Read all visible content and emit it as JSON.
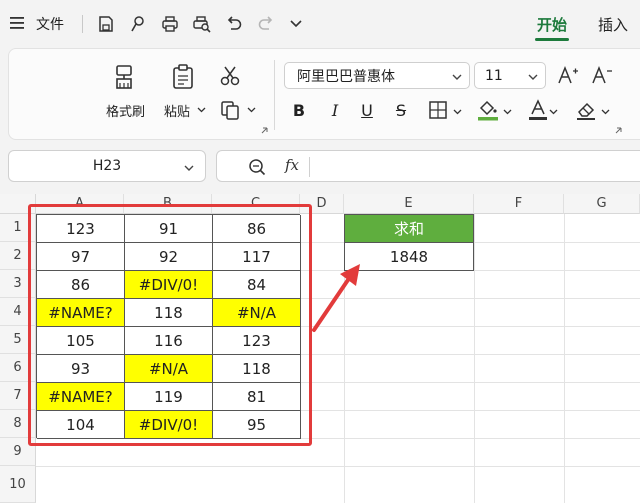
{
  "titlebar": {
    "file_label": "文件",
    "tabs": [
      {
        "label": "开始",
        "active": true
      },
      {
        "label": "插入",
        "active": false
      }
    ]
  },
  "ribbon": {
    "format_painter_label": "格式刷",
    "paste_label": "粘贴",
    "font_name": "阿里巴巴普惠体",
    "font_size": "11",
    "bold": "B",
    "italic": "I",
    "underline": "U",
    "strikethrough": "S",
    "accent_color": "#1d7a3c"
  },
  "namebox": {
    "value": "H23"
  },
  "formulabar": {
    "fx_label": "fx",
    "value": ""
  },
  "sheet": {
    "columns": [
      "A",
      "B",
      "C",
      "D",
      "E",
      "F",
      "G"
    ],
    "rows": [
      "1",
      "2",
      "3",
      "4",
      "5",
      "6",
      "7",
      "8",
      "9",
      "10"
    ],
    "table": [
      [
        {
          "v": "123"
        },
        {
          "v": "91"
        },
        {
          "v": "86"
        }
      ],
      [
        {
          "v": "97"
        },
        {
          "v": "92"
        },
        {
          "v": "117"
        }
      ],
      [
        {
          "v": "86"
        },
        {
          "v": "#DIV/0!",
          "err": true
        },
        {
          "v": "84"
        }
      ],
      [
        {
          "v": "#NAME?",
          "err": true
        },
        {
          "v": "118"
        },
        {
          "v": "#N/A",
          "err": true
        }
      ],
      [
        {
          "v": "105"
        },
        {
          "v": "116"
        },
        {
          "v": "123"
        }
      ],
      [
        {
          "v": "93"
        },
        {
          "v": "#N/A",
          "err": true
        },
        {
          "v": "118"
        }
      ],
      [
        {
          "v": "#NAME?",
          "err": true
        },
        {
          "v": "119"
        },
        {
          "v": "81"
        }
      ],
      [
        {
          "v": "104"
        },
        {
          "v": "#DIV/0!",
          "err": true
        },
        {
          "v": "95"
        }
      ]
    ],
    "sum_header": "求和",
    "sum_value": "1848",
    "error_fill_color": "#ffff00",
    "sum_header_color": "#5fae3e",
    "highlight_color": "#e23b3b"
  }
}
